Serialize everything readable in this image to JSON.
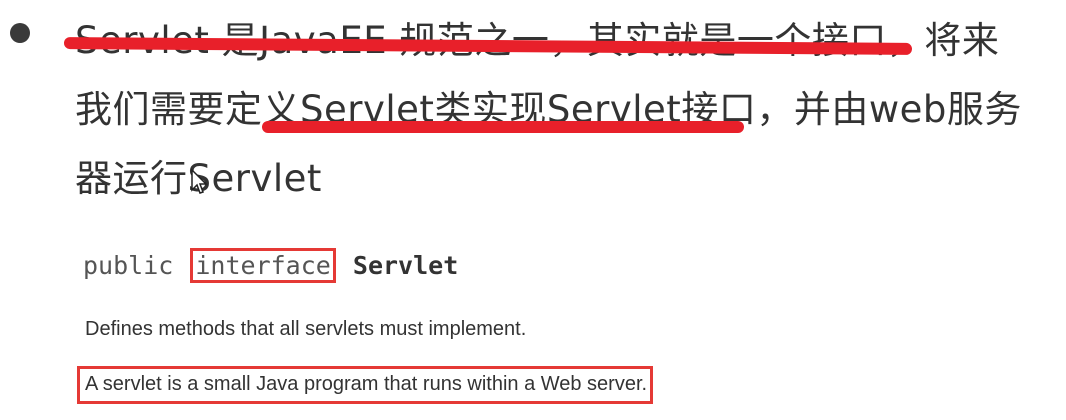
{
  "bullet_text": {
    "part1": "Servlet 是JavaEE 规范之一，其实就是一个接口，将来",
    "part2": "我们需要定义Servlet类实现Servlet接口，并由web服务",
    "part3": "器运行Servlet"
  },
  "code_signature": {
    "modifier": "public",
    "keyword": "interface",
    "class_name": "Servlet"
  },
  "descriptions": {
    "line1": "Defines methods that all servlets must implement.",
    "line2": "A servlet is a small Java program that runs within a Web server."
  },
  "colors": {
    "annotation_red": "#e53935",
    "text": "#333333"
  }
}
